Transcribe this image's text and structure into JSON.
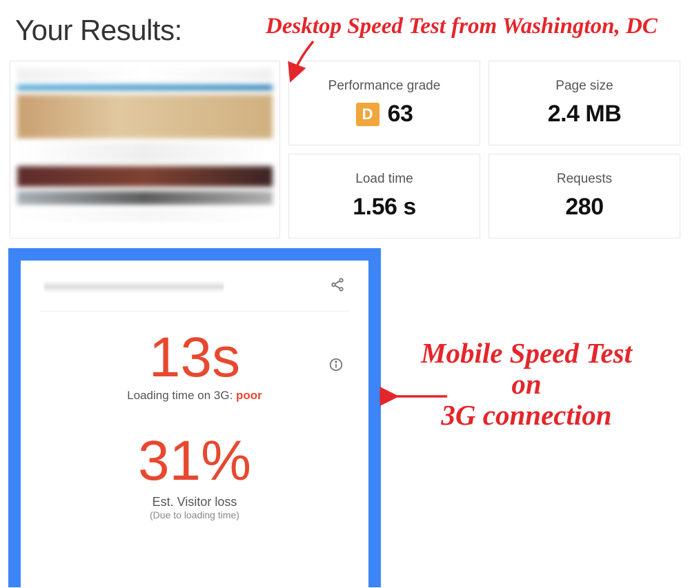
{
  "page_title": "Your Results:",
  "annotations": {
    "top": "Desktop Speed Test from Washington, DC",
    "side_line1": "Mobile Speed Test",
    "side_line2": "on",
    "side_line3": "3G connection"
  },
  "desktop": {
    "performance": {
      "label": "Performance grade",
      "grade_letter": "D",
      "score": "63"
    },
    "page_size": {
      "label": "Page size",
      "value": "2.4 MB"
    },
    "load_time": {
      "label": "Load time",
      "value": "1.56 s"
    },
    "requests": {
      "label": "Requests",
      "value": "280"
    }
  },
  "mobile": {
    "loading_value": "13s",
    "loading_label_prefix": "Loading time on 3G: ",
    "loading_rating": "poor",
    "visitor_loss_value": "31%",
    "visitor_loss_label": "Est. Visitor loss",
    "visitor_loss_sub": "(Due to loading time)"
  },
  "icons": {
    "share": "share-icon",
    "info": "info-icon"
  },
  "colors": {
    "annotation_red": "#e4262b",
    "metric_red": "#e7482f",
    "grade_orange": "#f0a63c",
    "mobile_frame_blue": "#3d84f7"
  }
}
